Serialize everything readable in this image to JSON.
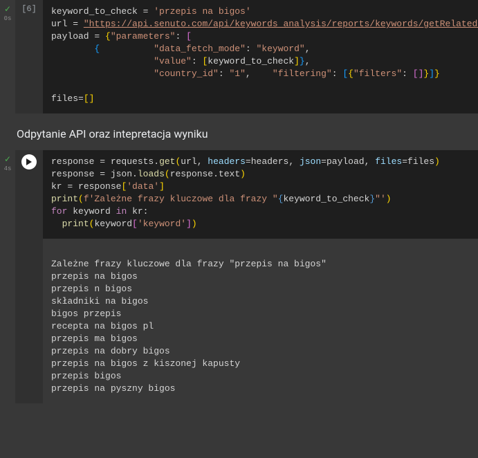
{
  "cell1": {
    "exec_label": "[6]",
    "status_icon": "check",
    "time": "0s",
    "code": {
      "l1_var": "keyword_to_check",
      "l1_eq": " = ",
      "l1_str": "'przepis na bigos'",
      "l2_var": "url",
      "l2_eq": " = ",
      "l2_str": "\"https://api.senuto.com/api/keywords_analysis/reports/keywords/getRelated\"",
      "l3_var": "payload",
      "l3_eq": " = ",
      "l3_open": "{",
      "l3_k1": "\"parameters\"",
      "l3_colon": ": ",
      "l3_brkO": "[",
      "l4_pad": "        ",
      "l4_open": "{",
      "l4_pad2": "          ",
      "l4_k": "\"data_fetch_mode\"",
      "l4_c": ": ",
      "l4_v": "\"keyword\"",
      "l4_comma": ",",
      "l5_pad": "                   ",
      "l5_k": "\"value\"",
      "l5_c": ": ",
      "l5_bo": "[",
      "l5_v": "keyword_to_check",
      "l5_bc": "]",
      "l5_cc": "}",
      "l5_comma": ",",
      "l6_pad": "                   ",
      "l6_k1": "\"country_id\"",
      "l6_c1": ": ",
      "l6_v1": "\"1\"",
      "l6_comma1": ",    ",
      "l6_k2": "\"filtering\"",
      "l6_c2": ": ",
      "l6_bo": "[",
      "l6_co": "{",
      "l6_k3": "\"filters\"",
      "l6_c3": ": ",
      "l6_bo2": "[",
      "l6_bc2": "]",
      "l6_cc": "}",
      "l6_bc": "]",
      "l6_cc2": "}",
      "l8_var": "files",
      "l8_eq": "=",
      "l8_bo": "[",
      "l8_bc": "]"
    }
  },
  "heading": "Odpytanie API oraz intepretacja wyniku",
  "cell2": {
    "status_icon": "check",
    "time": "4s",
    "code": {
      "l1_var": "response",
      "l1_eq": " = ",
      "l1_obj": "requests",
      "l1_dot": ".",
      "l1_fn": "get",
      "l1_po": "(",
      "l1_a1": "url",
      "l1_c1": ", ",
      "l1_kw1": "headers",
      "l1_eq1": "=",
      "l1_v1": "headers",
      "l1_c2": ", ",
      "l1_kw2": "json",
      "l1_eq2": "=",
      "l1_v2": "payload",
      "l1_c3": ", ",
      "l1_kw3": "files",
      "l1_eq3": "=",
      "l1_v3": "files",
      "l1_pc": ")",
      "l2_var": "response",
      "l2_eq": " = ",
      "l2_obj": "json",
      "l2_dot": ".",
      "l2_fn": "loads",
      "l2_po": "(",
      "l2_a1": "response",
      "l2_dot2": ".",
      "l2_a2": "text",
      "l2_pc": ")",
      "l3_var": "kr",
      "l3_eq": " = ",
      "l3_obj": "response",
      "l3_bo": "[",
      "l3_k": "'data'",
      "l3_bc": "]",
      "l4_fn": "print",
      "l4_po": "(",
      "l4_f": "f'Zależne frazy kluczowe dla frazy \"",
      "l4_co": "{",
      "l4_v": "keyword_to_check",
      "l4_cc": "}",
      "l4_f2": "\"'",
      "l4_pc": ")",
      "l5_for": "for",
      "l5_sp": " ",
      "l5_v": "keyword",
      "l5_sp2": " ",
      "l5_in": "in",
      "l5_sp3": " ",
      "l5_it": "kr",
      "l5_colon": ":",
      "l6_pad": "  ",
      "l6_fn": "print",
      "l6_po": "(",
      "l6_v": "keyword",
      "l6_bo": "[",
      "l6_k": "'keyword'",
      "l6_bc": "]",
      "l6_pc": ")"
    },
    "output": [
      "Zależne frazy kluczowe dla frazy \"przepis na bigos\"",
      "przepis na bigos",
      "przepis n bigos",
      "składniki na bigos",
      "bigos przepis",
      "recepta na bigos pl",
      "przepis ma bigos",
      "przepis na dobry bigos",
      "przepis na bigos z kiszonej kapusty",
      "przepis bigos",
      "przepis na pyszny bigos"
    ]
  }
}
